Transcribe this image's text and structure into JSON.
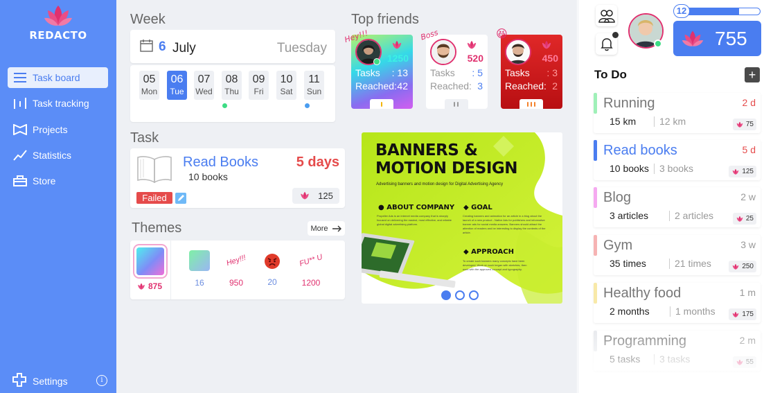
{
  "brand": {
    "name": "REDACTO",
    "color": "#e0316f"
  },
  "sidebar": {
    "items": [
      {
        "label": "Task board",
        "icon": "list-icon",
        "active": true
      },
      {
        "label": "Task tracking",
        "icon": "tracking-icon"
      },
      {
        "label": "Projects",
        "icon": "projects-icon"
      },
      {
        "label": "Statistics",
        "icon": "chart-line-icon"
      },
      {
        "label": "Store",
        "icon": "store-icon"
      }
    ],
    "settings_label": "Settings",
    "info_glyph": "i"
  },
  "week": {
    "title": "Week",
    "day": "6",
    "month": "July",
    "weekday": "Tuesday",
    "days": [
      {
        "num": "05",
        "label": "Mon"
      },
      {
        "num": "06",
        "label": "Tue",
        "active": true
      },
      {
        "num": "07",
        "label": "Wed"
      },
      {
        "num": "08",
        "label": "Thu",
        "dot": "#3ddc84"
      },
      {
        "num": "09",
        "label": "Fri"
      },
      {
        "num": "10",
        "label": "Sat"
      },
      {
        "num": "11",
        "label": "Sun",
        "dot": "#4a9df0"
      }
    ]
  },
  "friends": {
    "title": "Top friends",
    "tasks_label": "Tasks",
    "reached_label": "Reached:",
    "list": [
      {
        "tag": "Hey!!!",
        "score": "1250",
        "tasks": ": 13",
        "reached": "42",
        "theme": "gradient"
      },
      {
        "tag": "Boss",
        "score": "520",
        "tasks": ": 5",
        "reached": "3",
        "theme": "white"
      },
      {
        "tag": "😆",
        "score": "450",
        "tasks": ": 3",
        "reached": "2",
        "theme": "red"
      }
    ]
  },
  "task": {
    "title": "Task",
    "name": "Read Books",
    "subtitle": "10 books",
    "days": "5 days",
    "status": "Failed",
    "points": "125"
  },
  "themes": {
    "title": "Themes",
    "more_label": "More",
    "selected_price": "875",
    "options": [
      {
        "label": "16",
        "color": "#6b8de0"
      },
      {
        "label": "950",
        "decor": "Hey!!!",
        "color": "#e0316f"
      },
      {
        "label": "20",
        "color": "#6b8de0"
      },
      {
        "label": "1200",
        "decor": "FU** U",
        "color": "#e0316f"
      }
    ]
  },
  "banner": {
    "title_line1": "BANNERS &",
    "title_line2": "MOTION DESIGN",
    "tagline": "Advertising banners and motion design for Digital Advertising Agency",
    "about_title": "ABOUT COMPANY",
    "about_text": "Propeller Ads is an internet media company that is sharply focused on delivering the easiest, most effective, and reliable global digital advertising platform.",
    "goal_title": "GOAL",
    "goal_text": "Creating banners and animation for an article in a blog about the launch of a new product - Native Ads for publishers and informative banner ads for social media answers. Banners should attract the attention of readers and be interesting to display the contents of the article.",
    "approach_title": "APPROACH",
    "approach_text": "To create such banners many concepts have been developed. Work on such began with sketches, then work with the approved concept and typography.",
    "slides": 3,
    "active_slide": 1
  },
  "profile": {
    "level": "12",
    "level_progress": 0.73,
    "points": "755"
  },
  "todo": {
    "title": "To Do",
    "add_label": "+",
    "items": [
      {
        "title": "Running",
        "due": "2 d",
        "due_color": "#e54b4b",
        "current": "15 km",
        "goal": "12 km",
        "points": "75",
        "color": "#9ff0b8"
      },
      {
        "title": "Read books",
        "due": "5 d",
        "due_color": "#e54b4b",
        "current": "10 books",
        "goal": "3 books",
        "points": "125",
        "color": "#4a7df0",
        "title_color": "#4a7df0"
      },
      {
        "title": "Blog",
        "due": "2 w",
        "current": "3 articles",
        "goal": "2 articles",
        "points": "25",
        "color": "#f5a9f0"
      },
      {
        "title": "Gym",
        "due": "3 w",
        "current": "35 times",
        "goal": "21 times",
        "points": "250",
        "color": "#f6b3b3"
      },
      {
        "title": "Healthy food",
        "due": "1 m",
        "current": "2 months",
        "goal": "1 months",
        "points": "175",
        "color": "#f8e9a8"
      },
      {
        "title": "Programming",
        "due": "2 m",
        "current": "5 tasks",
        "goal": "3 tasks",
        "points": "55",
        "color": "#d8dbe0"
      }
    ]
  }
}
